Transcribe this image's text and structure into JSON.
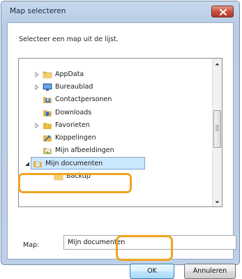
{
  "window": {
    "title": "Map selecteren",
    "close_icon": "close-icon"
  },
  "instruction": "Selecteer een map uit de lijst.",
  "tree": {
    "items": [
      {
        "label": "AppData",
        "icon": "folder-icon",
        "expander": "collapsed",
        "selected": false
      },
      {
        "label": "Bureaublad",
        "icon": "desktop-folder-icon",
        "expander": "collapsed",
        "selected": false
      },
      {
        "label": "Contactpersonen",
        "icon": "contacts-folder-icon",
        "expander": "none",
        "selected": false
      },
      {
        "label": "Downloads",
        "icon": "downloads-folder-icon",
        "expander": "none",
        "selected": false
      },
      {
        "label": "Favorieten",
        "icon": "favorites-folder-icon",
        "expander": "collapsed",
        "selected": false
      },
      {
        "label": "Koppelingen",
        "icon": "links-folder-icon",
        "expander": "none",
        "selected": false
      },
      {
        "label": "Mijn afbeeldingen",
        "icon": "pictures-folder-icon",
        "expander": "none",
        "selected": false
      },
      {
        "label": "Mijn documenten",
        "icon": "documents-folder-icon",
        "expander": "expanded",
        "selected": true
      },
      {
        "label": "Backup",
        "icon": "folder-icon",
        "expander": "none",
        "selected": false
      }
    ]
  },
  "map_field": {
    "label": "Map:",
    "value": "Mijn documenten"
  },
  "buttons": {
    "ok": "OK",
    "cancel": "Annuleren"
  },
  "colors": {
    "highlight": "#f2a321",
    "selection": "#cce8ff"
  }
}
